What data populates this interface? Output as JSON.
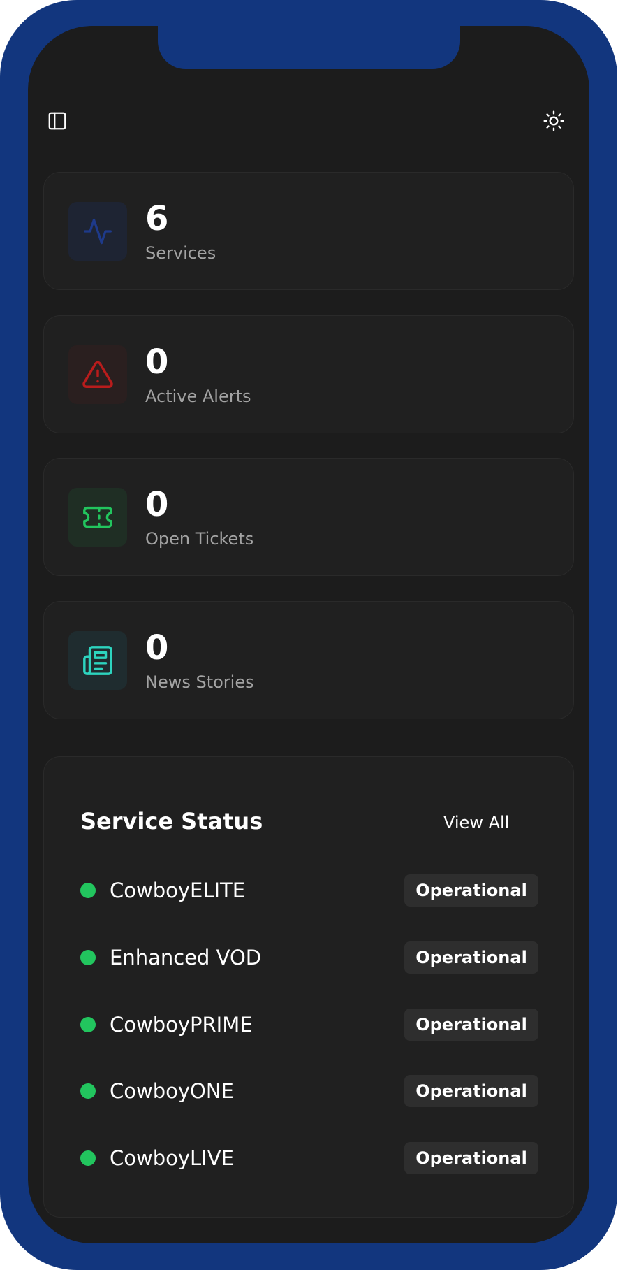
{
  "header": {
    "sidebar_icon": "sidebar-panel-icon",
    "theme_icon": "sun-icon"
  },
  "stats": [
    {
      "value": "6",
      "label": "Services",
      "icon": "activity-pulse-icon",
      "accent": "#1e3a8a",
      "bg": "#1e2433"
    },
    {
      "value": "0",
      "label": "Active Alerts",
      "icon": "alert-triangle-icon",
      "accent": "#b91c1c",
      "bg": "#2a1f1f"
    },
    {
      "value": "0",
      "label": "Open Tickets",
      "icon": "ticket-icon",
      "accent": "#22c55e",
      "bg": "#1f2e24"
    },
    {
      "value": "0",
      "label": "News Stories",
      "icon": "newspaper-icon",
      "accent": "#2dd4bf",
      "bg": "#1f2c2f"
    }
  ],
  "service_status": {
    "title": "Service Status",
    "view_all": "View All",
    "status_color": "#22c55e",
    "services": [
      {
        "name": "CowboyELITE",
        "status": "Operational"
      },
      {
        "name": "Enhanced VOD",
        "status": "Operational"
      },
      {
        "name": "CowboyPRIME",
        "status": "Operational"
      },
      {
        "name": "CowboyONE",
        "status": "Operational"
      },
      {
        "name": "CowboyLIVE",
        "status": "Operational"
      }
    ]
  }
}
